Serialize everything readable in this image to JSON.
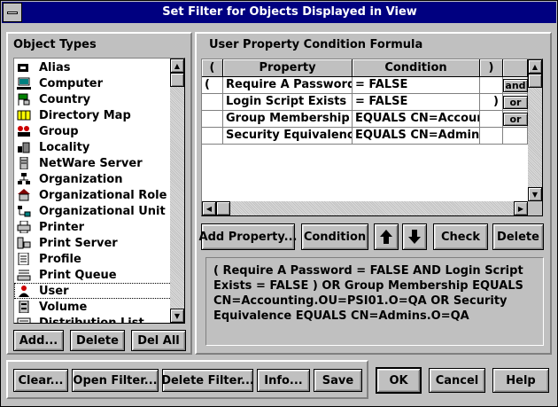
{
  "window": {
    "title": "Set Filter for Objects Displayed in View"
  },
  "object_types": {
    "heading": "Object Types",
    "items": [
      {
        "label": "Alias",
        "icon": "alias-icon"
      },
      {
        "label": "Computer",
        "icon": "computer-icon"
      },
      {
        "label": "Country",
        "icon": "country-icon"
      },
      {
        "label": "Directory Map",
        "icon": "directory-map-icon"
      },
      {
        "label": "Group",
        "icon": "group-icon"
      },
      {
        "label": "Locality",
        "icon": "locality-icon"
      },
      {
        "label": "NetWare Server",
        "icon": "server-icon"
      },
      {
        "label": "Organization",
        "icon": "organization-icon"
      },
      {
        "label": "Organizational Role",
        "icon": "role-icon"
      },
      {
        "label": "Organizational Unit",
        "icon": "unit-icon"
      },
      {
        "label": "Printer",
        "icon": "printer-icon"
      },
      {
        "label": "Print Server",
        "icon": "print-server-icon"
      },
      {
        "label": "Profile",
        "icon": "profile-icon"
      },
      {
        "label": "Print Queue",
        "icon": "print-queue-icon"
      },
      {
        "label": "User",
        "icon": "user-icon"
      },
      {
        "label": "Volume",
        "icon": "volume-icon"
      },
      {
        "label": "Distribution List",
        "icon": "distribution-list-icon"
      }
    ],
    "selected": "User",
    "buttons": {
      "add": "Add...",
      "delete": "Delete",
      "del_all": "Del All"
    }
  },
  "condition_formula": {
    "heading": "User Property Condition Formula",
    "columns": [
      "(",
      "Property",
      "Condition",
      ")",
      ""
    ],
    "rows": [
      {
        "open": "(",
        "property": "Require A Password",
        "condition": "= FALSE",
        "close": "",
        "op": "and"
      },
      {
        "open": "",
        "property": "Login Script Exists",
        "condition": "= FALSE",
        "close": ")",
        "op": "or"
      },
      {
        "open": "",
        "property": "Group Membership",
        "condition": "EQUALS CN=Accountin",
        "close": "",
        "op": "or"
      },
      {
        "open": "",
        "property": "Security Equivalence",
        "condition": "EQUALS CN=Admins.C",
        "close": "",
        "op": ""
      }
    ],
    "buttons": {
      "add_property": "Add Property...",
      "condition": "Condition",
      "check": "Check",
      "delete": "Delete"
    },
    "formula_text": "( Require A Password = FALSE  AND  Login Script Exists = FALSE ) OR  Group Membership EQUALS CN=Accounting.OU=PSI01.O=QA  OR  Security Equivalence EQUALS CN=Admins.O=QA"
  },
  "bottom_buttons": {
    "clear": "Clear...",
    "open_filter": "Open Filter...",
    "delete_filter": "Delete Filter...",
    "info": "Info...",
    "save": "Save",
    "ok": "OK",
    "cancel": "Cancel",
    "help": "Help"
  }
}
